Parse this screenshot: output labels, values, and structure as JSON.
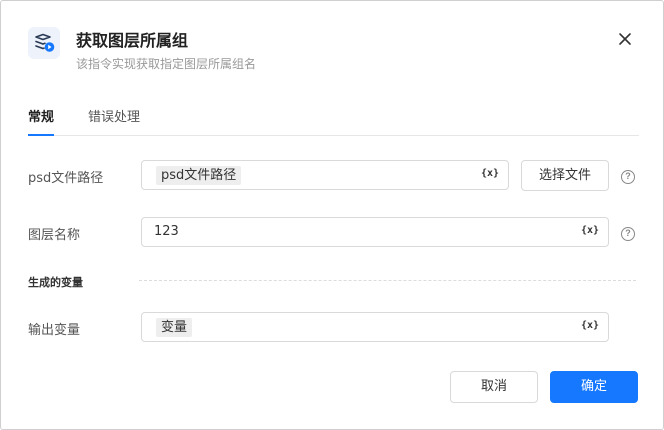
{
  "dialog": {
    "title": "获取图层所属组",
    "subtitle": "该指令实现获取指定图层所属组名",
    "close_icon": "close-icon"
  },
  "tabs": [
    {
      "label": "常规",
      "active": true
    },
    {
      "label": "错误处理",
      "active": false
    }
  ],
  "fields": {
    "psd_path": {
      "label": "psd文件路径",
      "value": "psd文件路径",
      "button": "选择文件"
    },
    "layer_name": {
      "label": "图层名称",
      "value": "123"
    },
    "output_var": {
      "label": "输出变量",
      "value": "变量"
    }
  },
  "variable_icon_text": "{x}",
  "help_text": "?",
  "section": {
    "generated_vars": "生成的变量"
  },
  "footer": {
    "cancel": "取消",
    "confirm": "确定"
  },
  "colors": {
    "primary": "#1677ff",
    "border": "#d9d9d9",
    "chip_bg": "#eeeeee"
  }
}
